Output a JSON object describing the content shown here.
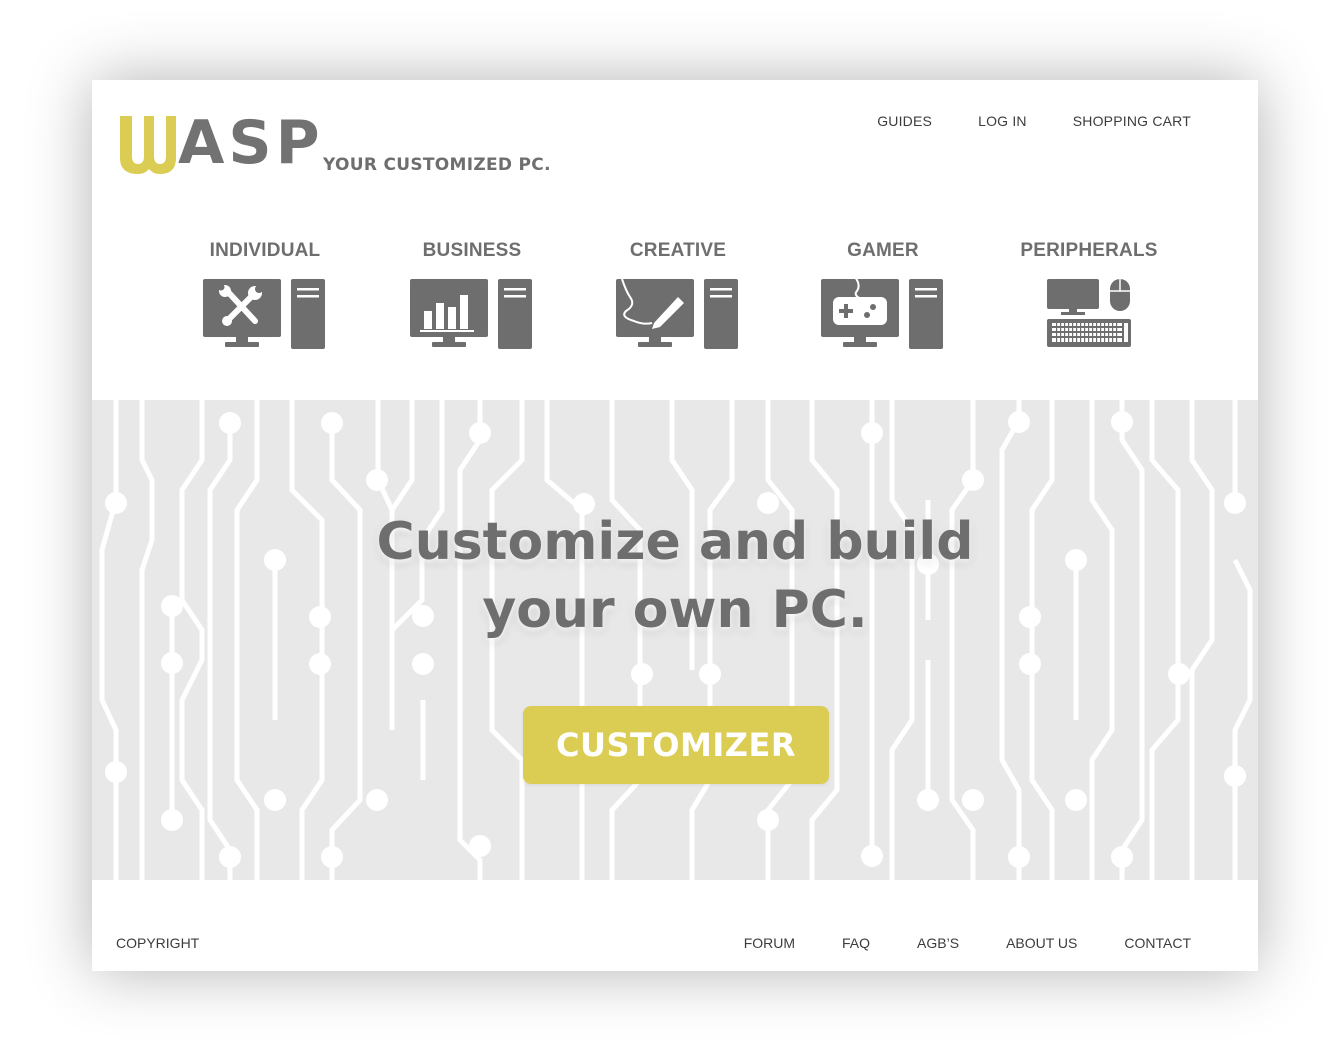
{
  "brand": {
    "logo_letter": "W",
    "logo_rest": "ASP",
    "tagline": "YOUR CUSTOMIZED PC.",
    "accent_color": "#dbcd53",
    "text_color": "#6e6e6e"
  },
  "topnav": {
    "items": [
      {
        "label": "GUIDES"
      },
      {
        "label": "LOG IN"
      },
      {
        "label": "SHOPPING CART"
      }
    ]
  },
  "categories": [
    {
      "label": "INDIVIDUAL",
      "icon": "tools-desktop-icon"
    },
    {
      "label": "BUSINESS",
      "icon": "bar-chart-desktop-icon"
    },
    {
      "label": "CREATIVE",
      "icon": "pen-tablet-desktop-icon"
    },
    {
      "label": "GAMER",
      "icon": "gamepad-desktop-icon"
    },
    {
      "label": "PERIPHERALS",
      "icon": "monitor-keyboard-mouse-icon"
    }
  ],
  "hero": {
    "title_line1": "Customize and build",
    "title_line2": "your own PC.",
    "cta_label": "CUSTOMIZER",
    "background_pattern": "circuit-board"
  },
  "footer": {
    "copyright": "COPYRIGHT",
    "links": [
      {
        "label": "FORUM"
      },
      {
        "label": "FAQ"
      },
      {
        "label": "AGB’S"
      },
      {
        "label": "ABOUT US"
      },
      {
        "label": "CONTACT"
      }
    ]
  }
}
